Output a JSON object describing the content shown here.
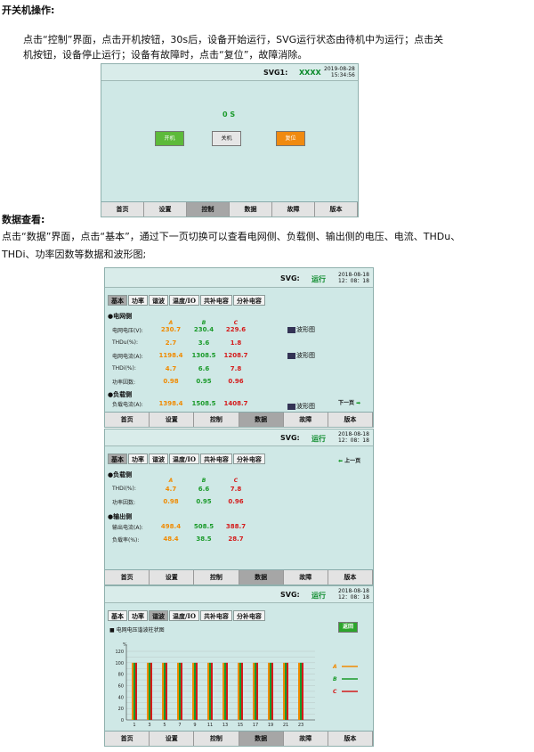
{
  "sec1": {
    "heading": "开关机操作:",
    "line1": "点击“控制”界面，点击开机按钮，30s后，设备开始运行，SVG运行状态由待机中为运行；点击关",
    "line2": "机按钮，设备停止运行；设备有故障时，点击“复位”，故障消除。"
  },
  "sec2": {
    "heading": "数据查看:",
    "line1": "点击“数据”界面，点击“基本”，通过下一页切换可以查看电网侧、负载侧、输出侧的电压、电流、THDu、",
    "line2": "THDi、功率因数等数据和波形图;"
  },
  "nav": [
    "首页",
    "设置",
    "控制",
    "数据",
    "故障",
    "版本"
  ],
  "s1": {
    "svg_label": "SVG1:",
    "status": "XXXX",
    "date": "2019-08-28",
    "time": "15:34:56",
    "countdown": "0 S",
    "buttons": {
      "on": "开机",
      "off": "关机",
      "reset": "复位"
    }
  },
  "tabs": [
    "基本",
    "功率",
    "谐波",
    "温度/IO",
    "共补电容",
    "分补电容"
  ],
  "s2": {
    "svg_label": "SVG:",
    "status": "运行",
    "date": "2018-08-18",
    "time": "12：08：18",
    "grid_title": "●电网侧",
    "phases": [
      "A",
      "B",
      "C"
    ],
    "rows": [
      {
        "label": "电网电压(V):",
        "a": "230.7",
        "b": "230.4",
        "c": "229.6"
      },
      {
        "label": "THDu(%):",
        "a": "2.7",
        "b": "3.6",
        "c": "1.8"
      },
      {
        "label": "电网电流(A):",
        "a": "1198.4",
        "b": "1308.5",
        "c": "1208.7"
      },
      {
        "label": "THDi(%):",
        "a": "4.7",
        "b": "6.6",
        "c": "7.8"
      },
      {
        "label": "功率因数:",
        "a": "0.98",
        "b": "0.95",
        "c": "0.96"
      }
    ],
    "load_title": "●负载侧",
    "load_row": {
      "label": "负载电流(A):",
      "a": "1398.4",
      "b": "1508.5",
      "c": "1408.7"
    },
    "waveform": "波形图",
    "next": "下一页"
  },
  "s3": {
    "svg_label": "SVG:",
    "status": "运行",
    "date": "2018-08-18",
    "time": "12：08：18",
    "load_title": "●负载侧",
    "prev": "上一页",
    "rows": [
      {
        "label": "THDi(%):",
        "a": "4.7",
        "b": "6.6",
        "c": "7.8"
      },
      {
        "label": "功率因数:",
        "a": "0.98",
        "b": "0.95",
        "c": "0.96"
      }
    ],
    "out_title": "●输出侧",
    "out_rows": [
      {
        "label": "输出电流(A):",
        "a": "498.4",
        "b": "508.5",
        "c": "388.7"
      },
      {
        "label": "负载率(%):",
        "a": "48.4",
        "b": "38.5",
        "c": "28.7"
      }
    ]
  },
  "s4": {
    "svg_label": "SVG:",
    "status": "运行",
    "date": "2018-08-18",
    "time": "12：08：18",
    "chart_title": "■ 电网电压谐波柱状图",
    "back": "返回",
    "unit": "%",
    "legend": [
      "A",
      "B",
      "C"
    ]
  },
  "chart_data": {
    "type": "bar",
    "title": "电网电压谐波柱状图",
    "ylabel": "%",
    "ylim": [
      0,
      120
    ],
    "yticks": [
      0,
      10,
      20,
      30,
      40,
      50,
      60,
      70,
      80,
      90,
      100,
      110,
      120
    ],
    "categories": [
      "1",
      "3",
      "5",
      "7",
      "9",
      "11",
      "13",
      "15",
      "17",
      "19",
      "21",
      "23"
    ],
    "series": [
      {
        "name": "A",
        "color": "#f08a00",
        "values": [
          100,
          100,
          100,
          100,
          100,
          100,
          100,
          100,
          100,
          100,
          100,
          100
        ]
      },
      {
        "name": "B",
        "color": "#1a9a2a",
        "values": [
          100,
          100,
          100,
          100,
          100,
          100,
          100,
          100,
          100,
          100,
          100,
          100
        ]
      },
      {
        "name": "C",
        "color": "#d41a1a",
        "values": [
          100,
          100,
          100,
          100,
          100,
          100,
          100,
          100,
          100,
          100,
          100,
          100
        ]
      }
    ]
  },
  "colors": {
    "phase_a": "#f08a00",
    "phase_b": "#1a9a2a",
    "phase_c": "#d41a1a",
    "screen_bg": "#cfe8e6"
  }
}
